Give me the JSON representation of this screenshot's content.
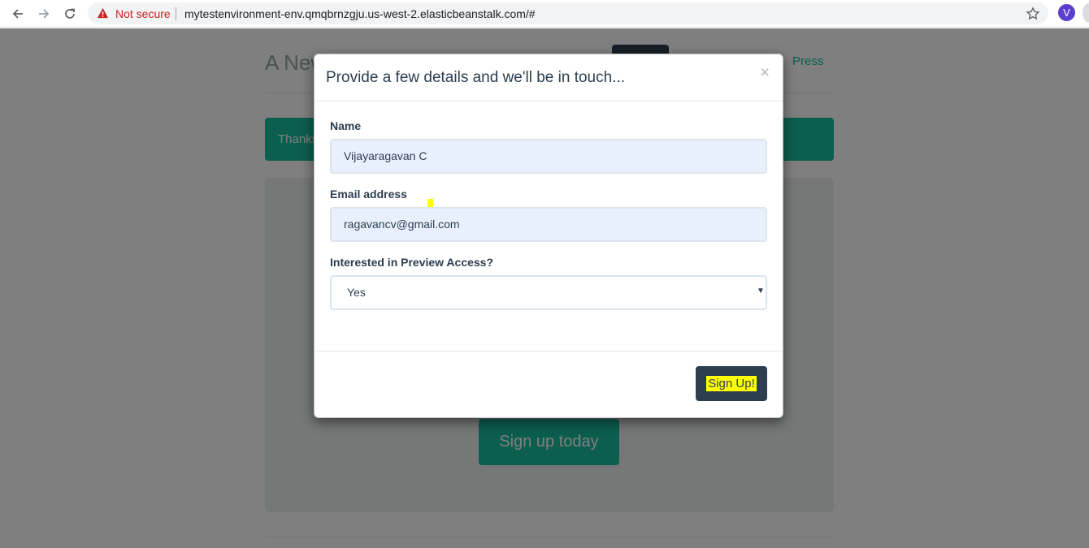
{
  "browser": {
    "security_label": "Not secure",
    "url": "mytestenvironment-env.qmqbrnzgju.us-west-2.elasticbeanstalk.com/#",
    "profile_initial": "V",
    "icons": [
      "back-arrow-icon",
      "forward-arrow-icon",
      "reload-icon",
      "warning-icon",
      "star-icon"
    ]
  },
  "page": {
    "brand": "A New",
    "nav_press": "Press",
    "alert_text": "Thanks",
    "cta_label": "Sign up today"
  },
  "modal": {
    "title": "Provide a few details and we'll be in touch...",
    "close_symbol": "×",
    "name_label": "Name",
    "name_value": "Vijayaragavan C",
    "email_label": "Email address",
    "email_value": "ragavancv@gmail.com",
    "preview_label": "Interested in Preview Access?",
    "preview_value": "Yes",
    "submit_label": "Sign Up!"
  },
  "colors": {
    "primary": "#2c3e50",
    "accent": "#18bc9c",
    "autofill": "#e8f0fe",
    "highlight": "#ffff00",
    "warning": "#c5221f"
  }
}
